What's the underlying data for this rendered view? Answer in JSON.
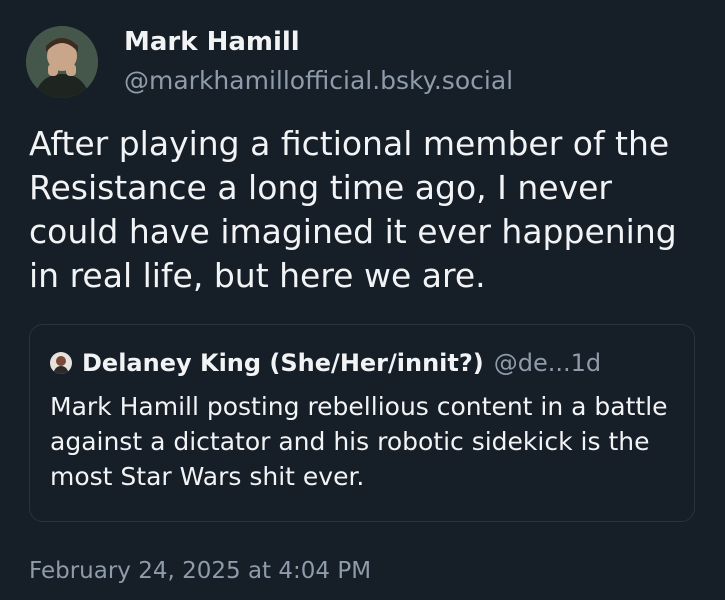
{
  "post": {
    "author_name": "Mark Hamill",
    "author_handle": "@markhamillofficial.bsky.social",
    "text": "After playing a fictional member of the Resistance a long time ago, I never could have imagined it ever happening in real life, but here we are.",
    "timestamp": "February 24, 2025 at 4:04 PM"
  },
  "quote": {
    "author_name": "Delaney King (She/Her/innit?)",
    "author_handle": "@de...",
    "age": "1d",
    "text": "Mark Hamill posting rebellious content in a battle against a dictator and his robotic sidekick is the most Star Wars shit ever."
  },
  "colors": {
    "background": "#161e27",
    "primary_text": "#f1f3f5",
    "secondary_text": "#8e9bab",
    "card_border": "#283440"
  },
  "icons": {
    "author_avatar": "avatar-photo",
    "quote_avatar": "avatar-photo"
  }
}
